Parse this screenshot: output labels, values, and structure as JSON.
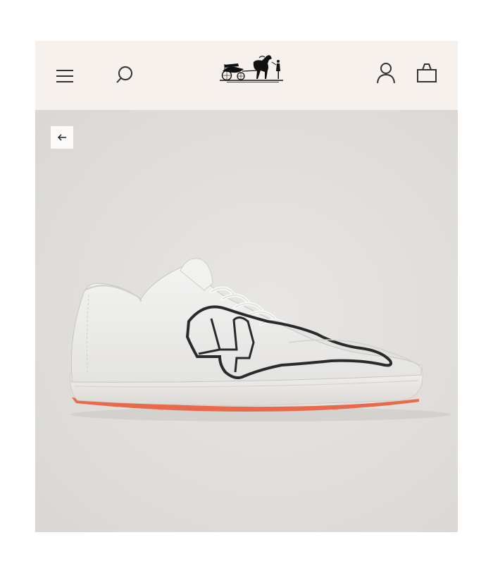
{
  "header": {
    "menu_icon": "hamburger-menu-icon",
    "search_icon": "search-icon",
    "logo": "hermes-carriage-logo",
    "account_icon": "user-icon",
    "bag_icon": "shopping-bag-icon",
    "background": "#f6f1ed"
  },
  "gallery": {
    "back_icon": "arrow-left-icon",
    "image": "white-leather-sneaker",
    "background": "#e0dedb"
  }
}
